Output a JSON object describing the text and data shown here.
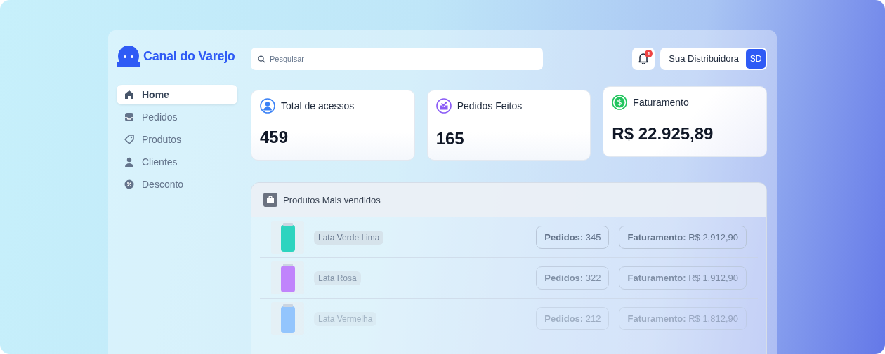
{
  "brand": {
    "name": "Canal do Varejo"
  },
  "sidebar": {
    "items": [
      {
        "label": "Home",
        "selected": true
      },
      {
        "label": "Pedidos",
        "selected": false
      },
      {
        "label": "Produtos",
        "selected": false
      },
      {
        "label": "Clientes",
        "selected": false
      },
      {
        "label": "Desconto",
        "selected": false
      }
    ]
  },
  "search": {
    "placeholder": "Pesquisar"
  },
  "notifications": {
    "count": "1"
  },
  "account": {
    "name": "Sua Distribuidora",
    "initials": "SD"
  },
  "stats": [
    {
      "title": "Total de acessos",
      "value": "459",
      "color": "#3b82f6"
    },
    {
      "title": "Pedidos Feitos",
      "value": "165",
      "color": "#8b5cf6"
    },
    {
      "title": "Faturamento",
      "value": "R$ 22.925,89",
      "color": "#22c55e"
    }
  ],
  "top_products": {
    "title": "Produtos Mais vendidos",
    "rows": [
      {
        "name": "Lata Verde Lima",
        "color": "#2dd4bf",
        "orders": "**Pedidos:** 345",
        "revenue": "**Faturamento:** R$ 2.912,90"
      },
      {
        "name": "Lata Rosa",
        "color": "#c084fc",
        "orders": "**Pedidos:** 322",
        "revenue": "**Faturamento:** R$ 1.912,90"
      },
      {
        "name": "Lata Vermelha",
        "color": "#93c5fd",
        "orders": "**Pedidos:** 212",
        "revenue": "**Faturamento:** R$ 1.812,90"
      }
    ]
  }
}
